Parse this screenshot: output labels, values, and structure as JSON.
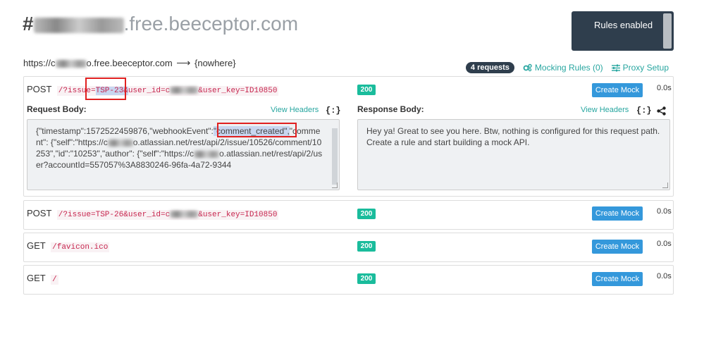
{
  "header": {
    "hash": "#",
    "domain_suffix": ".free.beeceptor.com"
  },
  "rules_toggle": {
    "label": "Rules enabled"
  },
  "proxy": {
    "url_prefix": "https://c",
    "url_suffix": "o.free.beeceptor.com",
    "arrow": "⟶",
    "target": "{nowhere}"
  },
  "toolbar": {
    "requests_badge": "4 requests",
    "mocking_rules": "Mocking Rules (0)",
    "proxy_setup": "Proxy Setup"
  },
  "requests": [
    {
      "method": "POST",
      "path_part1": "/?issue=",
      "path_highlight": "TSP-23&",
      "path_part2": "user_id=c",
      "path_part3": "&user_key=ID10850",
      "status": "200",
      "action": "Create Mock",
      "time": "0.0s"
    },
    {
      "method": "POST",
      "path_part1": "/?issue=TSP-26&user_id=c",
      "path_part3": "&user_key=ID10850",
      "status": "200",
      "action": "Create Mock",
      "time": "0.0s"
    },
    {
      "method": "GET",
      "path": "/favicon.ico",
      "status": "200",
      "action": "Create Mock",
      "time": "0.0s"
    },
    {
      "method": "GET",
      "path": "/",
      "status": "200",
      "action": "Create Mock",
      "time": "0.0s"
    }
  ],
  "detail": {
    "request_body_label": "Request Body:",
    "response_body_label": "Response Body:",
    "view_headers": "View Headers",
    "brace_icon": "{:}",
    "request_body_pre": "{\"timestamp\":1572522459876,\"webhookEvent\":",
    "request_body_highlight": "\"comment_created\",",
    "request_body_post1": "\"comment\": {\"self\":\"https://c",
    "request_body_post2": "o.atlassian.net/rest/api/2/issue/10526/comment/10253\",\"id\":\"10253\",\"author\": {\"self\":\"https://c",
    "request_body_post3": "o.atlassian.net/rest/api/2/user?accountId=557057%3A8830246-96fa-4a72-9344",
    "response_body": "Hey ya! Great to see you here. Btw, nothing is configured for this request path. Create a rule and start building a mock API."
  },
  "colors": {
    "teal": "#28a6a0",
    "status_green": "#1abc9c",
    "button_blue": "#3498db",
    "dark_navy": "#2f3e4d",
    "highlight_red": "#e02020"
  }
}
